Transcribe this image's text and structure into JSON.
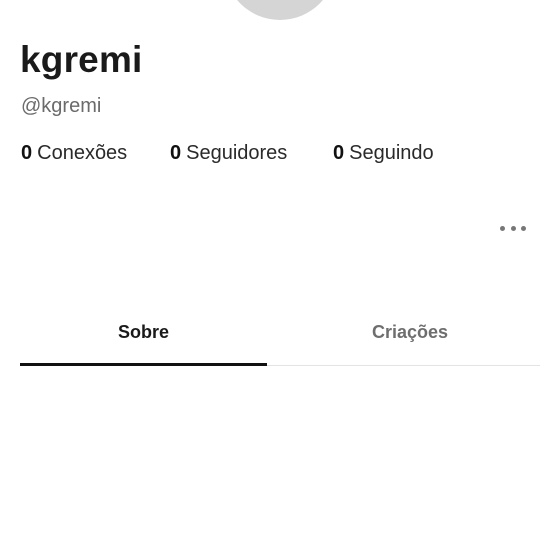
{
  "profile": {
    "display_name": "kgremi",
    "handle": "@kgremi"
  },
  "stats": {
    "connections": {
      "count": "0",
      "label": "Conexões"
    },
    "followers": {
      "count": "0",
      "label": "Seguidores"
    },
    "following": {
      "count": "0",
      "label": "Seguindo"
    }
  },
  "actions": {
    "more_icon": "more-horizontal-icon"
  },
  "tabs": [
    {
      "label": "Sobre",
      "selected": true
    },
    {
      "label": "Criações",
      "selected": false
    }
  ],
  "colors": {
    "text_primary": "#1a1a1a",
    "text_secondary": "#6b6b6b",
    "avatar_placeholder": "#d5d5d5",
    "tab_indicator": "#111111"
  }
}
